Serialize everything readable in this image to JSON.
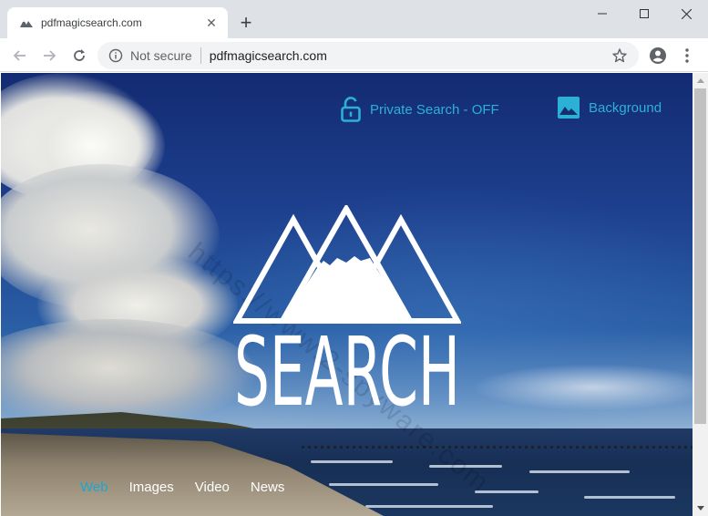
{
  "window": {
    "tab_title": "pdfmagicsearch.com",
    "tab_close": "✕",
    "new_tab": "+"
  },
  "toolbar": {
    "security_label": "Not secure",
    "url": "pdfmagicsearch.com"
  },
  "page": {
    "private_search_label": "Private Search - OFF",
    "background_label": "Background",
    "logo_word": "SEARCH",
    "watermark": "https://www.2-spyware.com",
    "nav_tabs": [
      {
        "label": "Web",
        "active": true
      },
      {
        "label": "Images",
        "active": false
      },
      {
        "label": "Video",
        "active": false
      },
      {
        "label": "News",
        "active": false
      }
    ]
  },
  "colors": {
    "accent": "#2db0d6",
    "active_tab": "#19a8d1",
    "chrome_bg": "#dee1e6"
  }
}
